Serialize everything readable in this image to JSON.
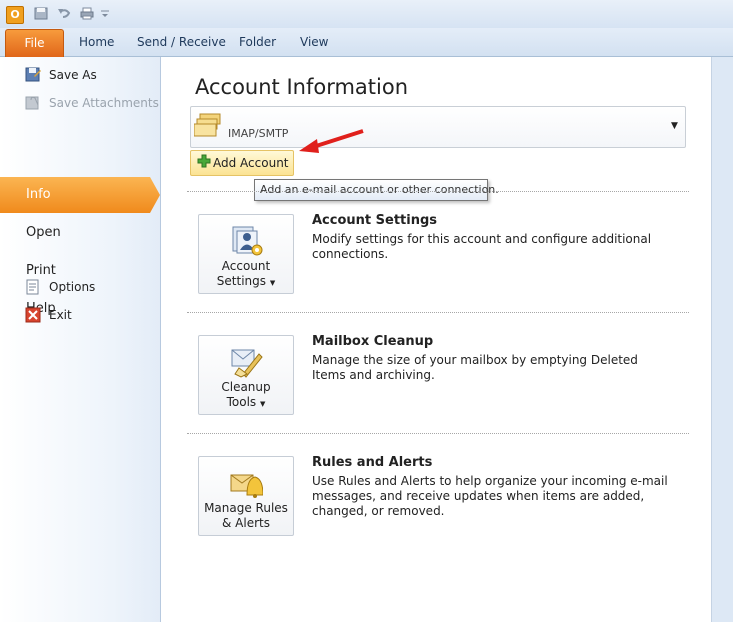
{
  "window": {
    "logo_letter": "O"
  },
  "ribbon": {
    "tabs": [
      "File",
      "Home",
      "Send / Receive",
      "Folder",
      "View"
    ]
  },
  "sidebar": {
    "save_as": "Save As",
    "save_attachments": "Save Attachments",
    "info": "Info",
    "open": "Open",
    "print": "Print",
    "help": "Help",
    "options": "Options",
    "exit": "Exit"
  },
  "main": {
    "title": "Account Information",
    "account_selector": "IMAP/SMTP",
    "add_account": "Add Account",
    "tooltip": "Add an e-mail account or other connection.",
    "sections": [
      {
        "button_line1": "Account",
        "button_line2": "Settings",
        "title": "Account Settings",
        "description": "Modify settings for this account and configure additional connections."
      },
      {
        "button_line1": "Cleanup",
        "button_line2": "Tools",
        "title": "Mailbox Cleanup",
        "description": "Manage the size of your mailbox by emptying Deleted Items and archiving."
      },
      {
        "button_line1": "Manage Rules",
        "button_line2": "& Alerts",
        "title": "Rules and Alerts",
        "description": "Use Rules and Alerts to help organize your incoming e-mail messages, and receive updates when items are added, changed, or removed."
      }
    ]
  },
  "colors": {
    "file_tab": "#e86f1f",
    "info_selected": "#f59a2f",
    "annotation_arrow": "#e0201c"
  },
  "icons": [
    "outlook-logo-icon",
    "save-icon",
    "undo-icon",
    "print-icon",
    "customize-qat-icon",
    "save-as-icon",
    "save-attachments-icon",
    "options-icon",
    "exit-icon",
    "accounts-icon",
    "add-icon",
    "account-settings-icon",
    "cleanup-tools-icon",
    "rules-alerts-icon"
  ]
}
